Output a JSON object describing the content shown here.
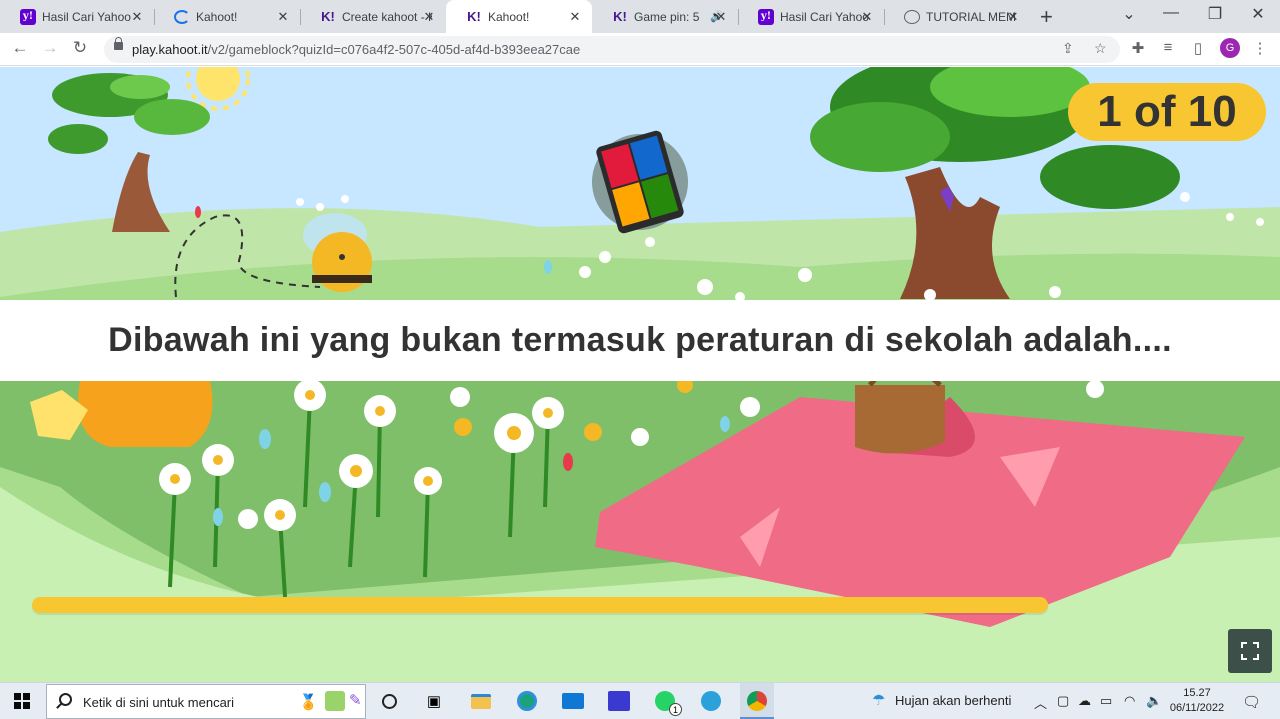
{
  "browser": {
    "tabs": [
      {
        "title": "Hasil Cari Yahoo",
        "icon": "yahoo-icon",
        "active": false
      },
      {
        "title": "Kahoot!",
        "icon": "loading-icon",
        "active": false
      },
      {
        "title": "Create kahoot - K",
        "icon": "kahoot-icon",
        "active": false
      },
      {
        "title": "Kahoot!",
        "icon": "kahoot-icon",
        "active": true
      },
      {
        "title": "Game pin: 5",
        "icon": "kahoot-icon",
        "active": false,
        "audio": true
      },
      {
        "title": "Hasil Cari Yahoo",
        "icon": "yahoo-icon",
        "active": false
      },
      {
        "title": "TUTORIAL MEMB",
        "icon": "globe-icon",
        "active": false
      }
    ],
    "url_domain": "play.kahoot.it",
    "url_path": "/v2/gameblock?quizId=c076a4f2-507c-405d-af4d-b393eea27cae",
    "profile_initial": "G"
  },
  "game": {
    "counter": "1 of 10",
    "question": "Dibawah ini yang bukan termasuk peraturan di sekolah adalah....",
    "timer_remaining_fraction": 0.8,
    "colors": {
      "sky": "#c7e6ff",
      "grass": "#a7dc8c",
      "field": "#7fbf6a",
      "timer": "#f8c630",
      "blanket": "#f06b86"
    }
  },
  "taskbar": {
    "search_placeholder": "Ketik di sini untuk mencari",
    "whatsapp_badge": "1",
    "weather": "Hujan akan berhenti",
    "time": "15.27",
    "date": "06/11/2022"
  }
}
